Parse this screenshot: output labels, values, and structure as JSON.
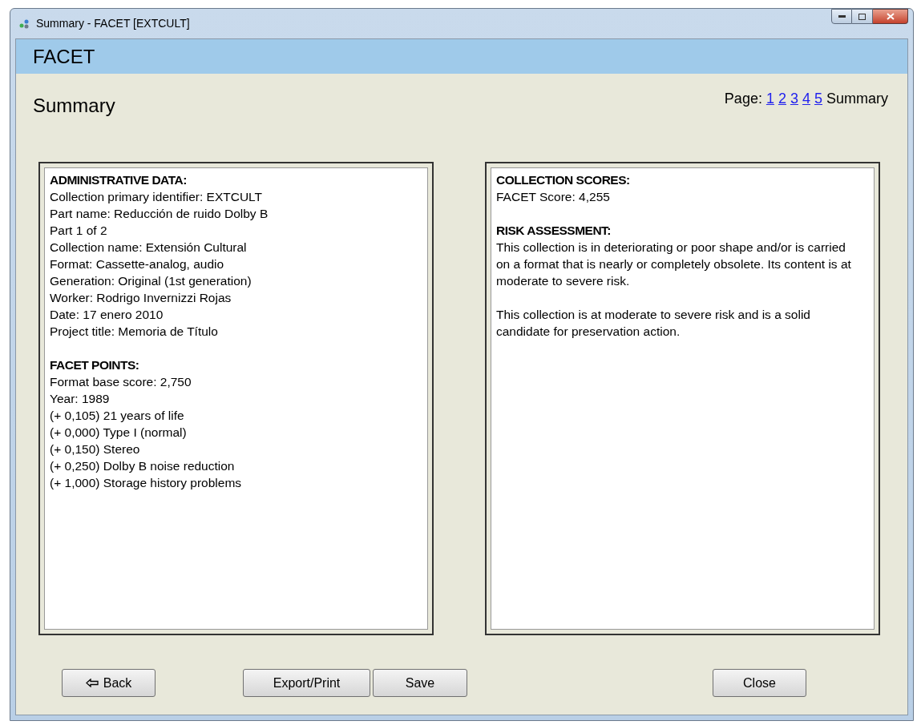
{
  "window": {
    "title": "Summary - FACET [EXTCULT]"
  },
  "header": {
    "title": "FACET"
  },
  "heading": "Summary",
  "pager": {
    "label": "Page:",
    "pages": [
      {
        "label": "1",
        "selected": false
      },
      {
        "label": "2",
        "selected": false
      },
      {
        "label": "3",
        "selected": false
      },
      {
        "label": "4",
        "selected": false
      },
      {
        "label": "5",
        "selected": false
      },
      {
        "label": "Summary",
        "selected": true
      }
    ]
  },
  "panels": [
    {
      "sections": [
        {
          "heading": "ADMINISTRATIVE DATA:",
          "lines": [
            "Collection primary identifier: EXTCULT",
            "Part name: Reducción de ruido Dolby B",
            "Part 1 of 2",
            "Collection name: Extensión Cultural",
            "Format: Cassette-analog, audio",
            "Generation: Original (1st generation)",
            "Worker: Rodrigo Invernizzi Rojas",
            "Date: 17 enero 2010",
            "Project title: Memoria de Título"
          ]
        },
        {
          "heading": "FACET POINTS:",
          "lines": [
            "Format base score: 2,750",
            "Year: 1989",
            "(+ 0,105) 21 years of life",
            "(+ 0,000) Type I (normal)",
            "(+ 0,150) Stereo",
            "(+ 0,250) Dolby B noise reduction",
            "(+ 1,000) Storage history problems"
          ]
        }
      ]
    },
    {
      "sections": [
        {
          "heading": "COLLECTION SCORES:",
          "lines": [
            "FACET Score: 4,255"
          ]
        },
        {
          "heading": "RISK ASSESSMENT:",
          "paragraphs": [
            "This collection is in deteriorating or poor shape and/or is carried on a format that is nearly or completely obsolete. Its content is at moderate to severe risk.",
            "This collection is at moderate to severe risk and is a solid candidate for preservation action."
          ]
        }
      ]
    }
  ],
  "buttons": [
    {
      "kind": "back",
      "label": "Back"
    },
    {
      "kind": "action",
      "label": "Export/Print"
    },
    {
      "kind": "action",
      "label": "Save"
    },
    {
      "kind": "close",
      "label": "Close"
    }
  ]
}
